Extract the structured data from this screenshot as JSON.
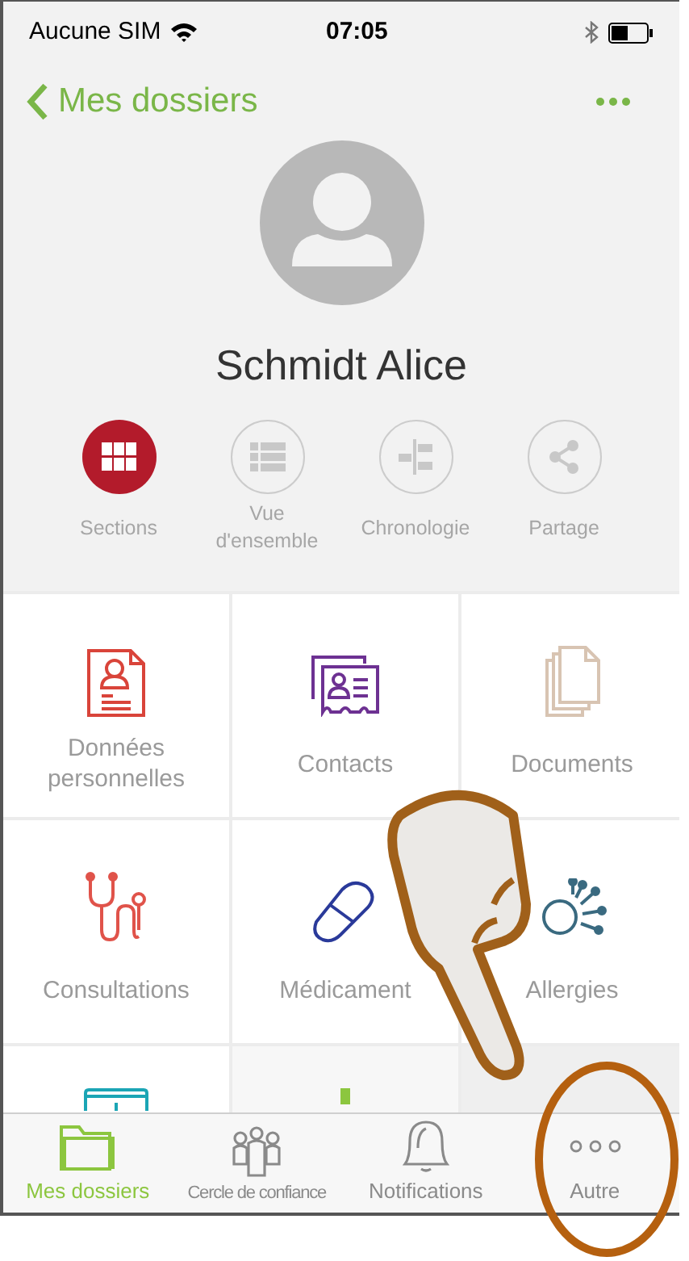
{
  "status_bar": {
    "carrier": "Aucune SIM",
    "time": "07:05"
  },
  "nav": {
    "back_label": "Mes dossiers"
  },
  "profile": {
    "name": "Schmidt Alice"
  },
  "view_tabs": [
    {
      "label": "Sections",
      "kind": "grid",
      "selected": true
    },
    {
      "label": "Vue d'ensemble",
      "kind": "list",
      "selected": false
    },
    {
      "label": "Chronologie",
      "kind": "timeline",
      "selected": false
    },
    {
      "label": "Partage",
      "kind": "share",
      "selected": false
    }
  ],
  "sections": [
    {
      "label": "Données personnelles",
      "kind": "profile"
    },
    {
      "label": "Contacts",
      "kind": "contact"
    },
    {
      "label": "Documents",
      "kind": "documents"
    },
    {
      "label": "Consultations",
      "kind": "stethoscope"
    },
    {
      "label": "Médicament",
      "kind": "capsule"
    },
    {
      "label": "Allergies",
      "kind": "allergy"
    },
    {
      "kind": "monitor"
    },
    {
      "kind": "chart"
    },
    {
      "kind": "blank"
    }
  ],
  "tab_bar": [
    {
      "label": "Mes dossiers",
      "kind": "folder",
      "selected": true
    },
    {
      "label": "Cercle de confiance",
      "kind": "people",
      "selected": false
    },
    {
      "label": "Notifications",
      "kind": "bell",
      "selected": false
    },
    {
      "label": "Autre",
      "kind": "dots",
      "selected": false
    }
  ]
}
